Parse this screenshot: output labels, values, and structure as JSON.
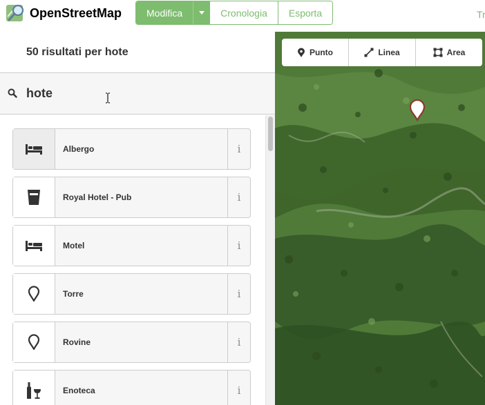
{
  "header": {
    "logo_text": "OpenStreetMap",
    "nav": {
      "edit_label": "Modifica",
      "history_label": "Cronologia",
      "export_label": "Esporta",
      "cut_label": "Tr"
    },
    "accent_color": "#7ebc6f"
  },
  "sidebar": {
    "title": "50 risultati per hote",
    "search_value": "hote",
    "presets": [
      {
        "label": "Albergo",
        "icon": "bed-icon",
        "info": "i"
      },
      {
        "label": "Royal Hotel - Pub",
        "icon": "pint-glass-icon",
        "info": "i"
      },
      {
        "label": "Motel",
        "icon": "bed-icon",
        "info": "i"
      },
      {
        "label": "Torre",
        "icon": "map-pin-icon",
        "info": "i"
      },
      {
        "label": "Rovine",
        "icon": "map-pin-icon",
        "info": "i"
      },
      {
        "label": "Enoteca",
        "icon": "wine-bottle-icon",
        "info": "i"
      }
    ]
  },
  "map": {
    "modes": {
      "point_label": "Punto",
      "line_label": "Linea",
      "area_label": "Area"
    }
  }
}
